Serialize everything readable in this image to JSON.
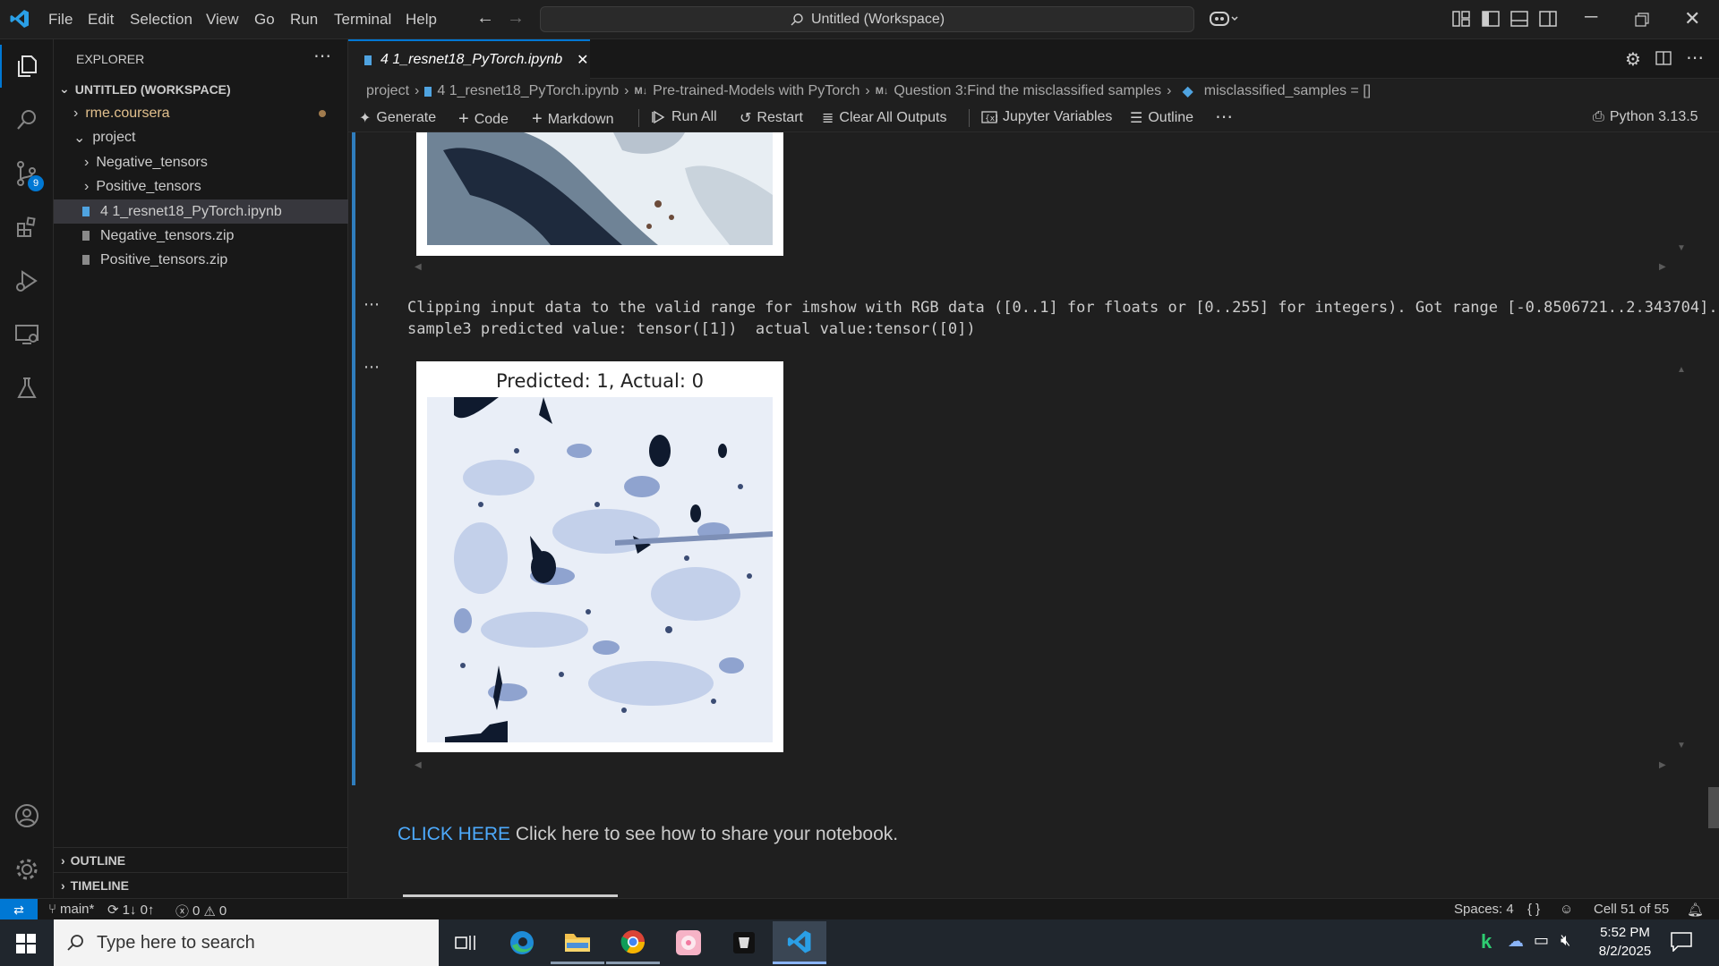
{
  "titlebar": {
    "menu": [
      "File",
      "Edit",
      "Selection",
      "View",
      "Go",
      "Run",
      "Terminal",
      "Help"
    ],
    "command_center": "Untitled (Workspace)"
  },
  "sidebar": {
    "title": "EXPLORER",
    "workspace": "UNTITLED (WORKSPACE)",
    "items": [
      {
        "label": "rme.coursera"
      },
      {
        "label": "project"
      },
      {
        "label": "Negative_tensors"
      },
      {
        "label": "Positive_tensors"
      },
      {
        "label": "4 1_resnet18_PyTorch.ipynb"
      },
      {
        "label": "Negative_tensors.zip"
      },
      {
        "label": "Positive_tensors.zip"
      }
    ],
    "outline": "OUTLINE",
    "timeline": "TIMELINE"
  },
  "activity": {
    "scm_badge": "9"
  },
  "tab": {
    "label": "4 1_resnet18_PyTorch.ipynb"
  },
  "breadcrumb": [
    "project",
    "4 1_resnet18_PyTorch.ipynb",
    "Pre-trained-Models with PyTorch",
    "Question 3:Find the misclassified samples",
    "misclassified_samples = []"
  ],
  "toolbar": {
    "generate": "Generate",
    "code": "Code",
    "markdown": "Markdown",
    "run_all": "Run All",
    "restart": "Restart",
    "clear_outputs": "Clear All Outputs",
    "jupyter_vars": "Jupyter Variables",
    "outline": "Outline",
    "kernel": "Python 3.13.5"
  },
  "output": {
    "line1": "Clipping input data to the valid range for imshow with RGB data ([0..1] for floats or [0..255] for integers). Got range [-0.8506721..2.343704].",
    "line2": "sample3 predicted value: tensor([1])  actual value:tensor([0])",
    "plot_title": "Predicted: 1, Actual: 0"
  },
  "markdown": {
    "link": "CLICK HERE",
    "text": " Click here to see how to share your notebook."
  },
  "statusbar": {
    "branch": "main*",
    "sync": "1↓ 0↑",
    "errors": "0",
    "warnings": "0",
    "spaces": "Spaces: 4",
    "cell": "Cell 51 of 55"
  },
  "taskbar": {
    "search_placeholder": "Type here to search",
    "time": "5:52 PM",
    "date": "8/2/2025"
  },
  "colors": {
    "accent": "#0078d4",
    "link": "#4daafc",
    "modified": "#e2c08d"
  }
}
